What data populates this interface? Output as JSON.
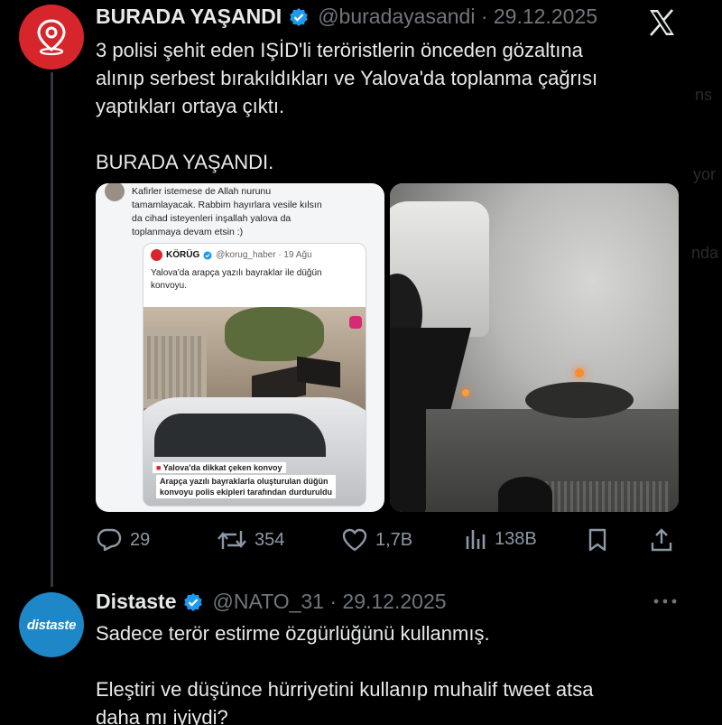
{
  "tweet1": {
    "name": "BURADA YAŞANDI",
    "handle": "@buradayasandi · 29.12.2025",
    "lines": [
      "3 polisi şehit eden IŞİD'li teröristlerin önceden gözaltına",
      "alınıp serbest bırakıldıkları ve Yalova'da toplanma çağrısı",
      "yaptıkları ortaya çıktı."
    ],
    "signature": "BURADA YAŞANDI.",
    "media_left": {
      "quote_text_lines": [
        "Kafirler istemese de Allah nurunu",
        "tamamlayacak. Rabbim hayırlara vesile kılsın",
        "da cihad isteyenleri inşallah yalova da",
        "toplanmaya devam etsin :)"
      ],
      "inner_name": "KÖRÜG",
      "inner_handle": "@korug_haber · 19 Ağu",
      "inner_text_lines": [
        "Yalova'da arapça yazılı bayraklar ile düğün",
        "konvoyu."
      ],
      "caption_title": "Yalova'da dikkat çeken konvoy",
      "caption_lines": [
        "Arapça yazılı bayraklarla oluşturulan düğün",
        "konvoyu polis ekipleri tarafından durduruldu"
      ]
    },
    "actions": {
      "replies": "29",
      "reposts": "354",
      "likes": "1,7B",
      "views": "138B"
    }
  },
  "tweet2": {
    "avatar_text": "distaste",
    "name": "Distaste",
    "handle": "@NATO_31 · 29.12.2025",
    "line1": "Sadece terör estirme özgürlüğünü kullanmış.",
    "line2": "Eleştiri ve düşünce hürriyetini kullanıp muhalif tweet atsa",
    "line3": "daha mı iyiydi?"
  },
  "colors": {
    "verified": "#1d9bf0",
    "avatar1": "#d6262c",
    "avatar2": "#1e87c7",
    "muted": "#71767b"
  }
}
